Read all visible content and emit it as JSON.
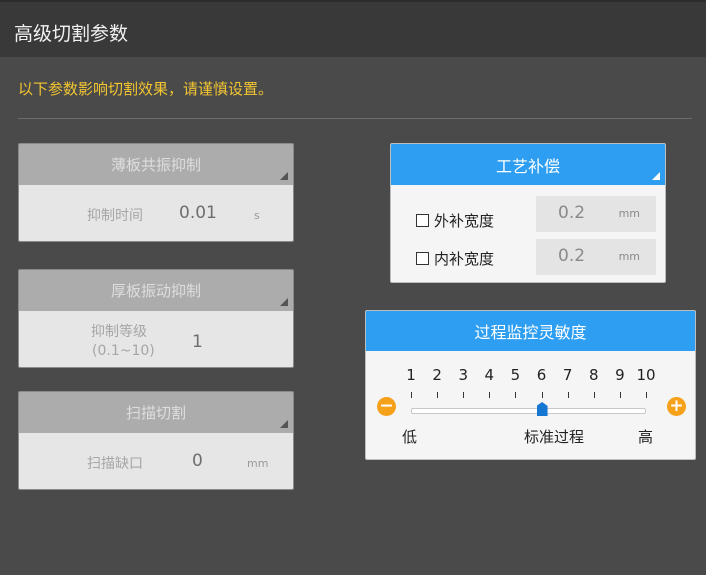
{
  "window": {
    "title": "高级切割参数"
  },
  "notice": "以下参数影响切割效果，请谨慎设置。",
  "thin_plate": {
    "title": "薄板共振抑制",
    "label": "抑制时间",
    "value": "0.01",
    "unit": "s"
  },
  "thick_plate": {
    "title": "厚板振动抑制",
    "label_line1": "抑制等级",
    "label_line2": "(0.1~10)",
    "value": "1"
  },
  "scan_cut": {
    "title": "扫描切割",
    "label": "扫描缺口",
    "value": "0",
    "unit": "mm"
  },
  "compensation": {
    "title": "工艺补偿",
    "outer": {
      "label": "外补宽度",
      "value": "0.2",
      "unit": "mm"
    },
    "inner": {
      "label": "内补宽度",
      "value": "0.2",
      "unit": "mm"
    }
  },
  "sensitivity": {
    "title": "过程监控灵敏度",
    "scale": [
      "1",
      "2",
      "3",
      "4",
      "5",
      "6",
      "7",
      "8",
      "9",
      "10"
    ],
    "level": 6,
    "min": 1,
    "max": 10,
    "low_label": "低",
    "standard_label": "标准过程",
    "high_label": "高",
    "decrease_symbol": "−",
    "increase_symbol": "+",
    "accent_color": "#2e9ef2",
    "thumb_color": "#1677d2",
    "step_button_color": "#f5a21a"
  }
}
